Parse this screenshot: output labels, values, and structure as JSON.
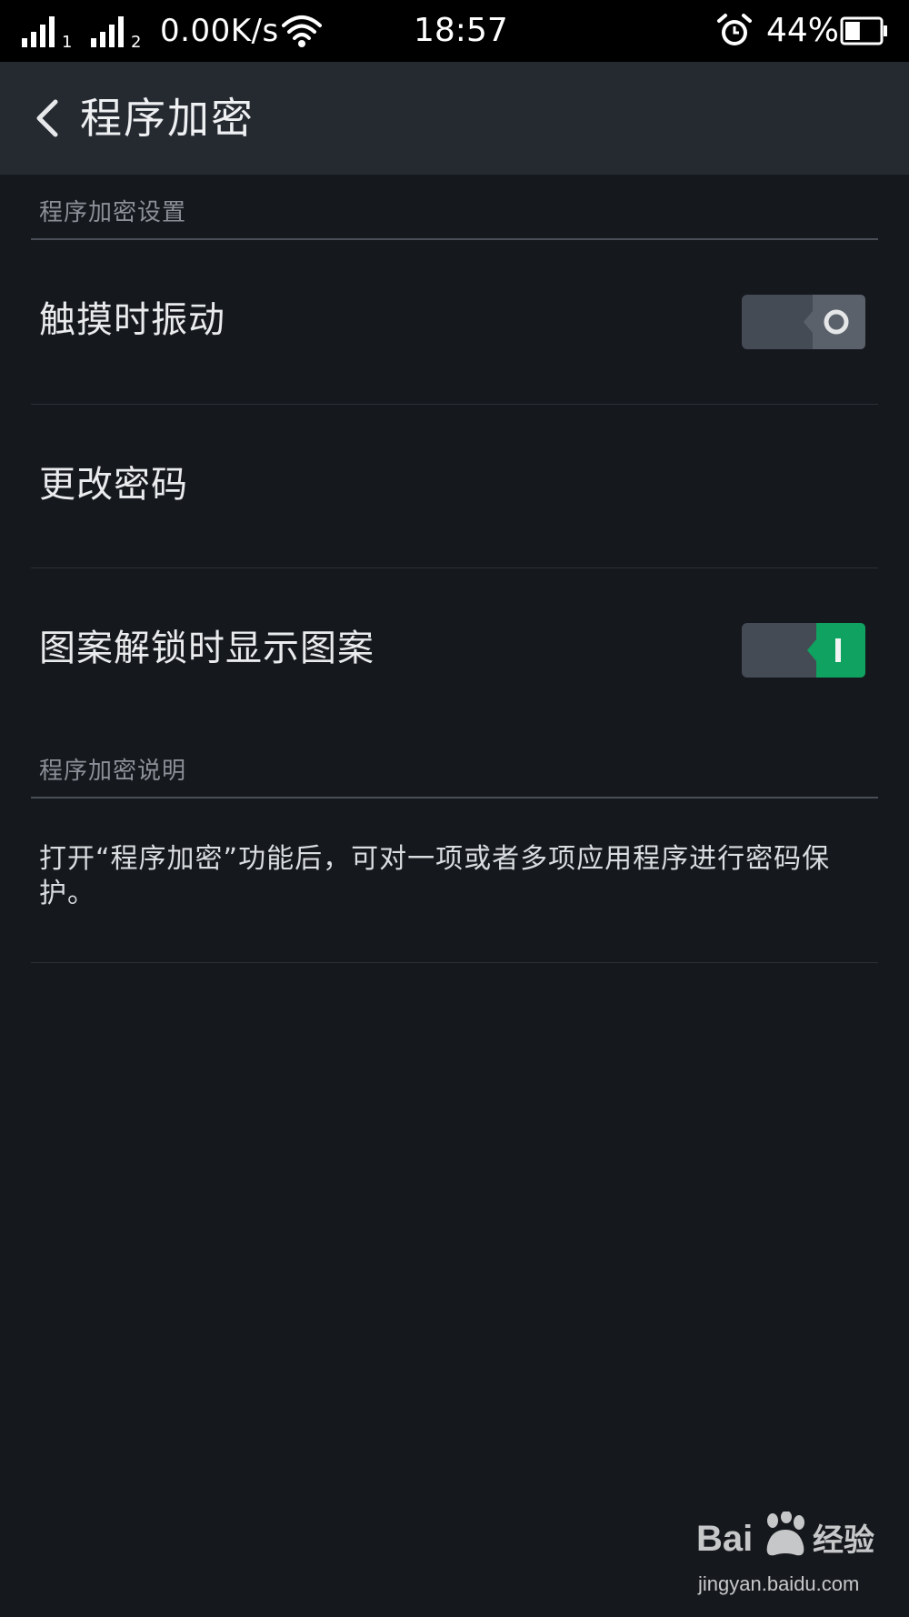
{
  "status_bar": {
    "sim1_label": "1",
    "sim2_label": "2",
    "net_speed": "0.00K/s",
    "time": "18:57",
    "battery_percent": "44%",
    "battery_level": 0.44,
    "icons": [
      "signal-icon",
      "wifi-icon",
      "alarm-icon",
      "battery-icon"
    ]
  },
  "header": {
    "back_icon": "chevron-left-icon",
    "title": "程序加密"
  },
  "settings_section": {
    "title": "程序加密设置",
    "items": [
      {
        "label": "触摸时振动",
        "type": "toggle",
        "state": "off"
      },
      {
        "label": "更改密码",
        "type": "link"
      },
      {
        "label": "图案解锁时显示图案",
        "type": "toggle",
        "state": "on"
      }
    ]
  },
  "description_section": {
    "title": "程序加密说明",
    "text": "打开“程序加密”功能后，可对一项或者多项应用程序进行密码保护。"
  },
  "colors": {
    "background": "#15181d",
    "header": "#252a31",
    "toggle_on": "#0fa260",
    "toggle_off": "#4f555e"
  },
  "watermark": {
    "brand": "Bai",
    "brand_cn": "经验",
    "url": "jingyan.baidu.com"
  }
}
